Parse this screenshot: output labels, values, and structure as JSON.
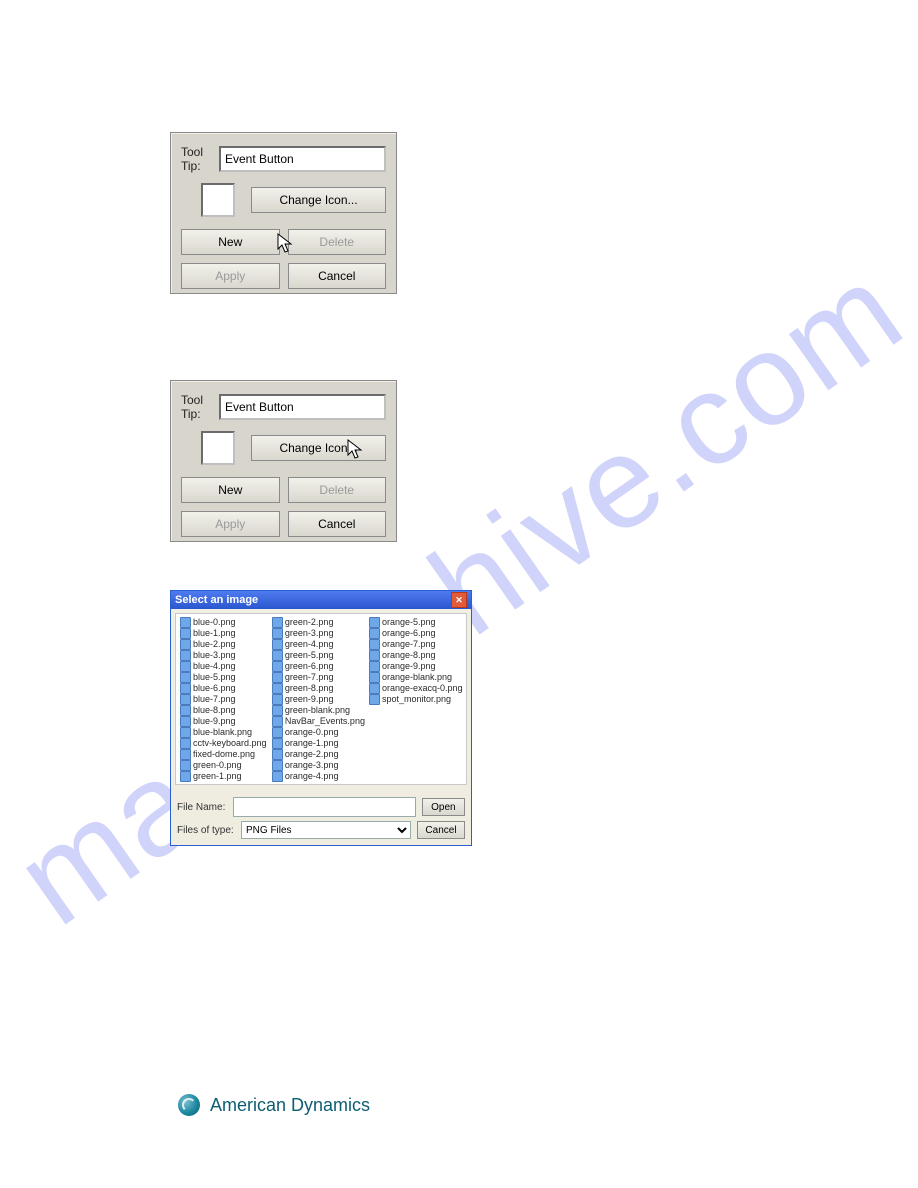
{
  "watermark": "manualshive.com",
  "panel_a": {
    "tool_tip_label": "Tool Tip:",
    "tool_tip_value": "Event Button",
    "change_icon": "Change Icon...",
    "new": "New",
    "delete": "Delete",
    "apply": "Apply",
    "cancel": "Cancel"
  },
  "panel_b": {
    "tool_tip_label": "Tool Tip:",
    "tool_tip_value": "Event Button",
    "change_icon": "Change Icon...",
    "new": "New",
    "delete": "Delete",
    "apply": "Apply",
    "cancel": "Cancel"
  },
  "file_dialog": {
    "title": "Select an image",
    "file_name_label": "File Name:",
    "file_name_value": "",
    "files_of_type_label": "Files of type:",
    "files_of_type_value": "PNG Files",
    "open": "Open",
    "cancel": "Cancel",
    "columns": [
      [
        "blue-0.png",
        "blue-1.png",
        "blue-2.png",
        "blue-3.png",
        "blue-4.png",
        "blue-5.png",
        "blue-6.png",
        "blue-7.png",
        "blue-8.png",
        "blue-9.png",
        "blue-blank.png",
        "cctv-keyboard.png",
        "fixed-dome.png",
        "green-0.png",
        "green-1.png"
      ],
      [
        "green-2.png",
        "green-3.png",
        "green-4.png",
        "green-5.png",
        "green-6.png",
        "green-7.png",
        "green-8.png",
        "green-9.png",
        "green-blank.png",
        "NavBar_Events.png",
        "orange-0.png",
        "orange-1.png",
        "orange-2.png",
        "orange-3.png",
        "orange-4.png"
      ],
      [
        "orange-5.png",
        "orange-6.png",
        "orange-7.png",
        "orange-8.png",
        "orange-9.png",
        "orange-blank.png",
        "orange-exacq-0.png",
        "spot_monitor.png"
      ]
    ]
  },
  "brand": "American Dynamics"
}
